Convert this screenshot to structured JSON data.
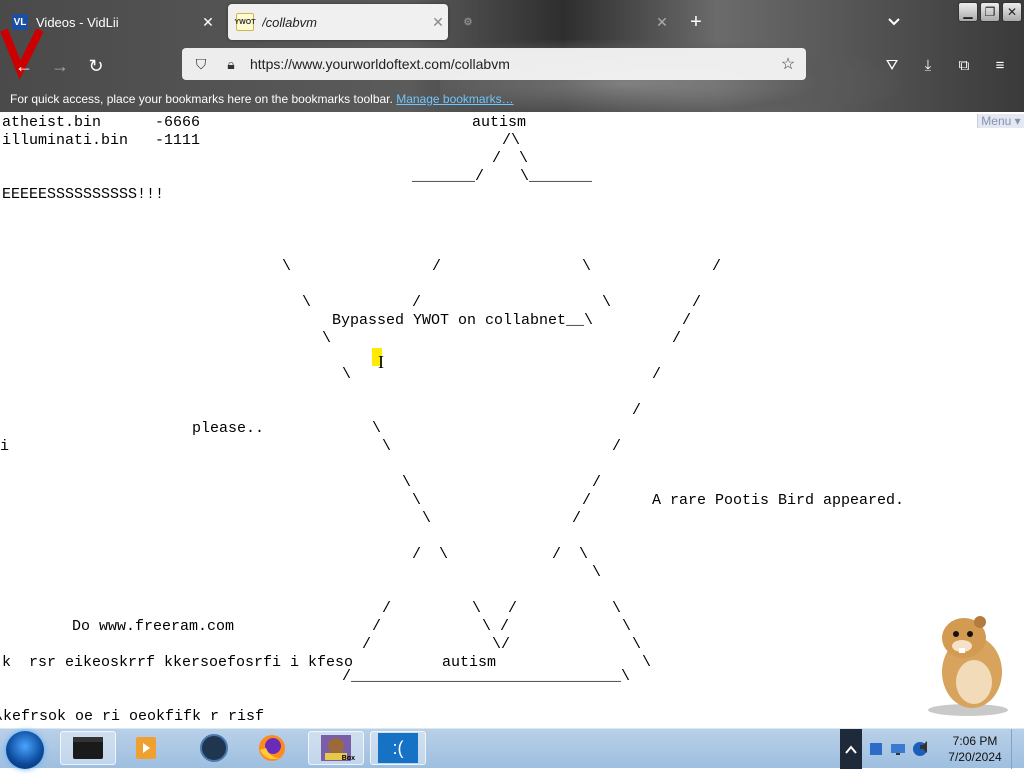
{
  "browser": {
    "tabs": [
      {
        "label": "Videos - VidLii",
        "icon": "vidlii-favicon",
        "favicon_text": "VL"
      },
      {
        "label": "/collabvm",
        "icon": "yourworldoftext-favicon",
        "favicon_text": "YWOT"
      },
      {
        "label": "",
        "icon": "settings-gear-icon"
      }
    ],
    "url": "https://www.yourworldoftext.com/collabvm",
    "bookmarks_bar_text": "For quick access, place your bookmarks here on the bookmarks toolbar.",
    "bookmarks_bar_link": "Manage bookmarks…"
  },
  "page": {
    "menu_label": "Menu",
    "lines": [
      {
        "text": "atheist.bin      -6666"
      },
      {
        "text": "illuminati.bin   -1111"
      },
      {
        "text": "autism"
      },
      {
        "text": "/\\"
      },
      {
        "text": "/  \\"
      },
      {
        "text": "_______/    \\_______"
      },
      {
        "text": "EEEEESSSSSSSSSS!!!"
      },
      {
        "text": "\\"
      },
      {
        "text": "/"
      },
      {
        "text": "\\"
      },
      {
        "text": "/"
      },
      {
        "text": "\\"
      },
      {
        "text": "/"
      },
      {
        "text": "\\"
      },
      {
        "text": "/"
      },
      {
        "text": "Bypassed YWOT on collabnet__\\"
      },
      {
        "text": "/"
      },
      {
        "text": "\\"
      },
      {
        "text": "/"
      },
      {
        "text": "\\"
      },
      {
        "text": "/"
      },
      {
        "text": "/"
      },
      {
        "text": "please.."
      },
      {
        "text": "\\"
      },
      {
        "text": "\\"
      },
      {
        "text": "/"
      },
      {
        "text": "i"
      },
      {
        "text": "\\"
      },
      {
        "text": "/"
      },
      {
        "text": "\\"
      },
      {
        "text": "/"
      },
      {
        "text": "A rare Pootis Bird appeared."
      },
      {
        "text": "\\"
      },
      {
        "text": "/"
      },
      {
        "text": "/  \\"
      },
      {
        "text": "/  \\"
      },
      {
        "text": "\\"
      },
      {
        "text": "/"
      },
      {
        "text": "\\   /"
      },
      {
        "text": "\\"
      },
      {
        "text": "Do www.freeram.com"
      },
      {
        "text": "/"
      },
      {
        "text": "\\ /"
      },
      {
        "text": "\\"
      },
      {
        "text": "/"
      },
      {
        "text": "\\/"
      },
      {
        "text": "\\"
      },
      {
        "text": "k  rsr eikeoskrrf kkersoefosrfi i kfeso"
      },
      {
        "text": "autism"
      },
      {
        "text": "\\"
      },
      {
        "text": "/______________________________\\"
      },
      {
        "text": "\\kefrsok oe ri oeokfifk r risf"
      }
    ]
  },
  "taskbar": {
    "items": [
      {
        "name": "terminal-app",
        "icon": "dark-window-icon"
      },
      {
        "name": "media-player-app",
        "icon": "media-player-icon"
      },
      {
        "name": "globe-app",
        "icon": "dark-globe-icon"
      },
      {
        "name": "firefox-app",
        "icon": "firefox-icon"
      },
      {
        "name": "bonzi-app",
        "icon": "bonzi-box-icon",
        "label": "Box"
      },
      {
        "name": "sad-face-app",
        "icon": "sad-face-icon",
        "label": ":("
      }
    ],
    "time": "7:06 PM",
    "date": "7/20/2024"
  }
}
